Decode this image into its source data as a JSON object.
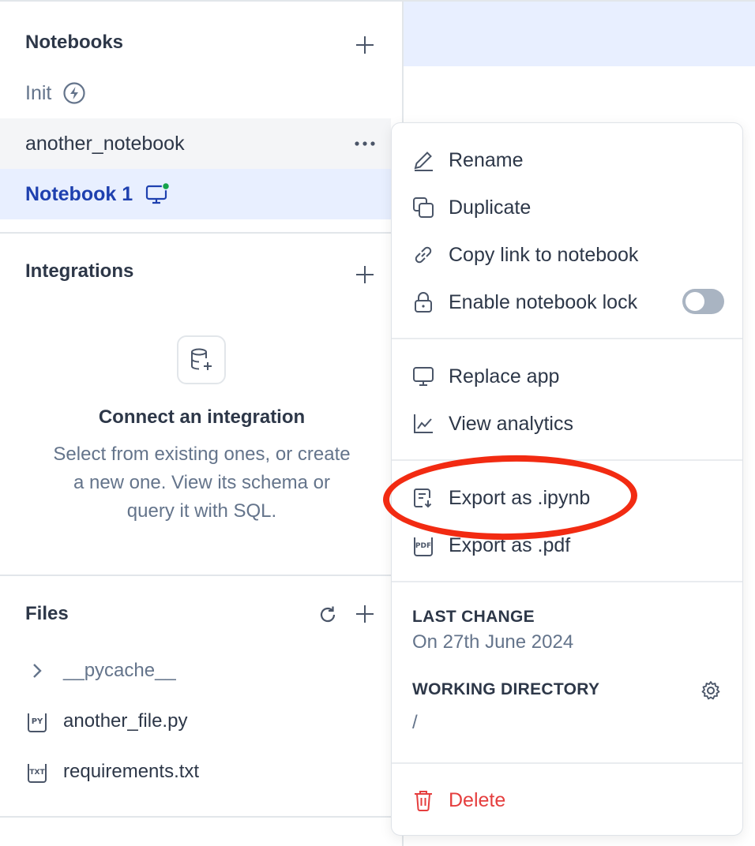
{
  "sidebar": {
    "notebooks": {
      "title": "Notebooks",
      "items": [
        {
          "label": "Init",
          "icon": "lightning-icon"
        },
        {
          "label": "another_notebook",
          "icon": "more-horizontal-icon"
        },
        {
          "label": "Notebook 1",
          "icon": "monitor-icon",
          "status": "active"
        }
      ]
    },
    "integrations": {
      "title": "Integrations",
      "empty_title": "Connect an integration",
      "empty_desc": "Select from existing ones, or create a new one. View its schema or query it with SQL."
    },
    "files": {
      "title": "Files",
      "items": [
        {
          "label": "__pycache__",
          "icon": "chevron-right-icon"
        },
        {
          "label": "another_file.py",
          "icon": "py-file-icon"
        },
        {
          "label": "requirements.txt",
          "icon": "txt-file-icon"
        }
      ]
    }
  },
  "menu": {
    "rename": "Rename",
    "duplicate": "Duplicate",
    "copy_link": "Copy link to notebook",
    "lock": "Enable notebook lock",
    "lock_enabled": false,
    "replace_app": "Replace app",
    "view_analytics": "View analytics",
    "export_ipynb": "Export as .ipynb",
    "export_pdf": "Export as .pdf",
    "last_change_label": "LAST CHANGE",
    "last_change_value": "On 27th June 2024",
    "working_dir_label": "WORKING DIRECTORY",
    "working_dir_value": "/",
    "delete": "Delete"
  },
  "colors": {
    "accent": "#1e40af",
    "active_bg": "#e8efff",
    "danger": "#e53e3e",
    "highlight": "#f22b12",
    "status_dot": "#16a34a"
  }
}
